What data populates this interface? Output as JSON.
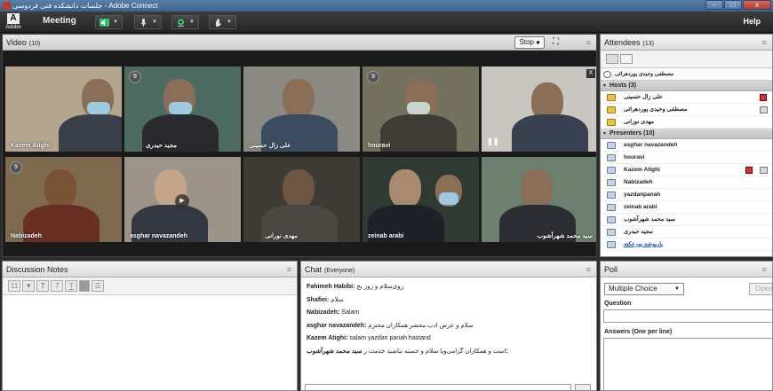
{
  "window": {
    "title": "جلسات دانشکده فنی فردوسی - Adobe Connect",
    "minimize": "–",
    "maximize": "□",
    "close": "x"
  },
  "menubar": {
    "logo_text": "Adobe",
    "logo_letter": "A",
    "meeting": "Meeting",
    "help": "Help",
    "dropdown": "▼"
  },
  "colors": {
    "speaker_active": "#2ec46b",
    "webcam_active": "#2ec46b",
    "accent": "#2b2b2b"
  },
  "video": {
    "title": "Video",
    "count": "(10)",
    "stop": "Stop",
    "fullscreen": "⛶",
    "menu": "≡",
    "tiles": [
      {
        "name": "Kazem Atighi",
        "pinned": false
      },
      {
        "name": "مجید حیدری",
        "pinned": true,
        "pin_label": "9"
      },
      {
        "name": "علی زال حسینی",
        "pinned": false
      },
      {
        "name": "houravi",
        "pinned": true,
        "pin_label": "9"
      },
      {
        "name": "",
        "pinned": false,
        "paused": true,
        "pause_label": "❚❚",
        "close_label": "X"
      },
      {
        "name": "Nabizadeh",
        "pinned": true,
        "pin_label": "9"
      },
      {
        "name": "asghar navazandeh",
        "pinned": false,
        "play": true,
        "play_label": "▶"
      },
      {
        "name": "مهدی نورانی",
        "pinned": false
      },
      {
        "name": "zeinab arabi",
        "pinned": false
      },
      {
        "name": "سید محمد شهرآشوب",
        "pinned": false
      }
    ]
  },
  "attendees": {
    "title": "Attendees",
    "count": "(13)",
    "menu": "≡",
    "self": "مصطفی وحیدی پوردهرائی",
    "hosts_label": "Hosts (3)",
    "hosts": [
      "علی زال حسینی",
      "مصطفی وحیدی پوردهرائی",
      "مهدی نورانی"
    ],
    "presenters_label": "Presenters (10)",
    "presenters": [
      "asghar navazandeh",
      "houravi",
      "Kazem Atighi",
      "Nabizadeh",
      "yazdanpanah",
      "zeinab arabi",
      "سید محمد شهرآشوب",
      "مجید حیدری",
      "پاریوشه پورعکته"
    ]
  },
  "notes": {
    "title": "Discussion Notes",
    "menu": "≡",
    "font_size": "11",
    "bold": "T",
    "italic": "T",
    "underline": "T",
    "list": "☰"
  },
  "chat": {
    "title": "Chat",
    "audience": "(Everyone)",
    "menu": "≡",
    "messages": [
      {
        "sender": "Fahimeh Habibi:",
        "text": "روی‌سلام و روز بخ"
      },
      {
        "sender": "Shafiei:",
        "text": "سلام"
      },
      {
        "sender": "Nabizadeh:",
        "text": "Salam"
      },
      {
        "sender": "asghar navazandeh:",
        "text": "سلام و عرض ادب محضر همکاران محترم"
      },
      {
        "sender": "Kazem Atighi:",
        "text": "salam  yazdan panah  hastand"
      },
      {
        "sender": "سید محمد شهرآشوب:",
        "text": "است و همکاران گرامی‌ویا سلام و خسته نباشید خدمت ر"
      }
    ]
  },
  "poll": {
    "title": "Poll",
    "menu": "≡",
    "type": "Multiple Choice",
    "open": "Open",
    "question_label": "Question",
    "answers_label": "Answers (One per line)"
  }
}
